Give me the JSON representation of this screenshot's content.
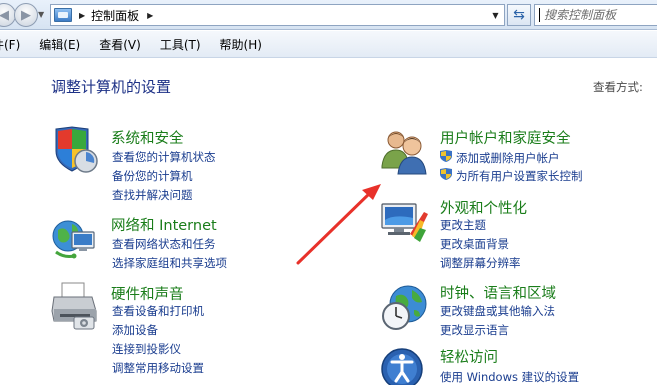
{
  "address": {
    "path": "控制面板",
    "search_placeholder": "搜索控制面板"
  },
  "menu": [
    "文件(F)",
    "编辑(E)",
    "查看(V)",
    "工具(T)",
    "帮助(H)"
  ],
  "menu_visible": [
    "件(F)",
    "编辑(E)",
    "查看(V)",
    "工具(T)",
    "帮助(H)"
  ],
  "page_title": "调整计算机的设置",
  "view_by": "查看方式:",
  "left": [
    {
      "title": "系统和安全",
      "icon": "shield-pc-icon",
      "links": [
        "查看您的计算机状态",
        "备份您的计算机",
        "查找并解决问题"
      ]
    },
    {
      "title": "网络和 Internet",
      "icon": "network-globe-icon",
      "links": [
        "查看网络状态和任务",
        "选择家庭组和共享选项"
      ]
    },
    {
      "title": "硬件和声音",
      "icon": "printer-icon",
      "links": [
        "查看设备和打印机",
        "添加设备",
        "连接到投影仪",
        "调整常用移动设置"
      ]
    }
  ],
  "right": [
    {
      "title": "用户帐户和家庭安全",
      "icon": "users-icon",
      "links": [
        "添加或删除用户帐户",
        "为所有用户设置家长控制"
      ]
    },
    {
      "title": "外观和个性化",
      "icon": "monitor-palette-icon",
      "links": [
        "更改主题",
        "更改桌面背景",
        "调整屏幕分辨率"
      ]
    },
    {
      "title": "时钟、语言和区域",
      "icon": "globe-clock-icon",
      "links": [
        "更改键盘或其他输入法",
        "更改显示语言"
      ]
    },
    {
      "title": "轻松访问",
      "icon": "ease-of-access-icon",
      "links": [
        "使用 Windows 建议的设置"
      ]
    }
  ],
  "colors": {
    "category_title": "#1a7d1a",
    "link": "#1a3d8f",
    "page_title": "#1e3287",
    "annotation_arrow": "#e8312a"
  }
}
